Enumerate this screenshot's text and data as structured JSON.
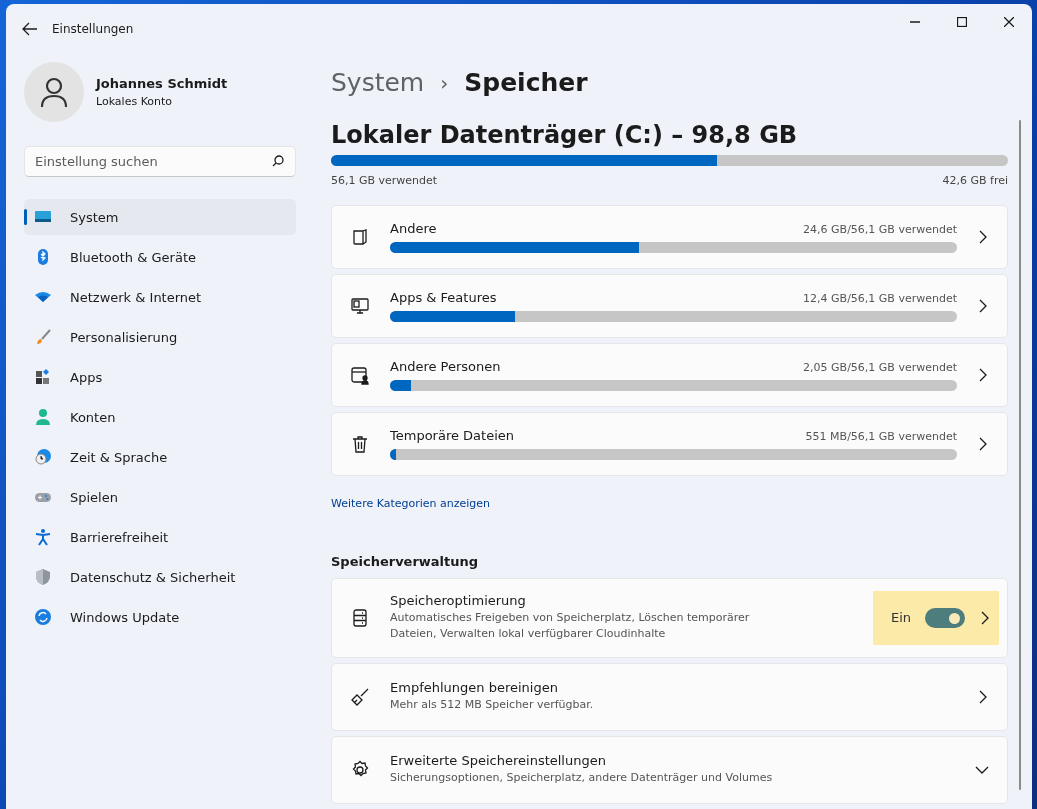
{
  "window": {
    "title": "Einstellungen"
  },
  "profile": {
    "name": "Johannes Schmidt",
    "account": "Lokales Konto"
  },
  "search": {
    "placeholder": "Einstellung suchen"
  },
  "sidebar": {
    "items": [
      {
        "label": "System",
        "kind": "system",
        "selected": true
      },
      {
        "label": "Bluetooth & Geräte",
        "kind": "bluetooth",
        "selected": false
      },
      {
        "label": "Netzwerk & Internet",
        "kind": "network",
        "selected": false
      },
      {
        "label": "Personalisierung",
        "kind": "brush",
        "selected": false
      },
      {
        "label": "Apps",
        "kind": "apps",
        "selected": false
      },
      {
        "label": "Konten",
        "kind": "account",
        "selected": false
      },
      {
        "label": "Zeit & Sprache",
        "kind": "time",
        "selected": false
      },
      {
        "label": "Spielen",
        "kind": "gaming",
        "selected": false
      },
      {
        "label": "Barrierefreiheit",
        "kind": "accessibility",
        "selected": false
      },
      {
        "label": "Datenschutz & Sicherheit",
        "kind": "shield",
        "selected": false
      },
      {
        "label": "Windows Update",
        "kind": "update",
        "selected": false
      }
    ]
  },
  "breadcrumb": {
    "parent": "System",
    "separator": "›",
    "current": "Speicher"
  },
  "disk": {
    "title": "Lokaler Datenträger (C:) – 98,8 GB",
    "level": 0.57,
    "used": "56,1 GB verwendet",
    "free": "42,6 GB frei"
  },
  "categories": [
    {
      "label": "Andere",
      "kind": "document",
      "usage": "24,6 GB/56,1 GB verwendet",
      "level": 0.44
    },
    {
      "label": "Apps & Features",
      "kind": "apps",
      "usage": "12,4 GB/56,1 GB verwendet",
      "level": 0.22
    },
    {
      "label": "Andere Personen",
      "kind": "person",
      "usage": "2,05 GB/56,1 GB verwendet",
      "level": 0.037
    },
    {
      "label": "Temporäre Dateien",
      "kind": "trash",
      "usage": "551 MB/56,1 GB verwendet",
      "level": 0.01
    }
  ],
  "more_link": "Weitere Kategorien anzeigen",
  "management": {
    "heading": "Speicherverwaltung",
    "items": [
      {
        "title": "Speicheroptimierung",
        "description": "Automatisches Freigeben von Speicherplatz, Löschen temporärer Dateien, Verwalten lokal verfügbarer Cloudinhalte",
        "kind": "storage",
        "toggle_label": "Ein",
        "on": true,
        "highlighted": true,
        "collapsible": false
      },
      {
        "title": "Empfehlungen bereinigen",
        "description": "Mehr als 512 MB Speicher verfügbar.",
        "kind": "broom",
        "collapsible": false
      },
      {
        "title": "Erweiterte Speichereinstellungen",
        "description": "Sicherungsoptionen, Speicherplatz, andere Datenträger und Volumes",
        "kind": "gear",
        "collapsible": true
      }
    ]
  }
}
